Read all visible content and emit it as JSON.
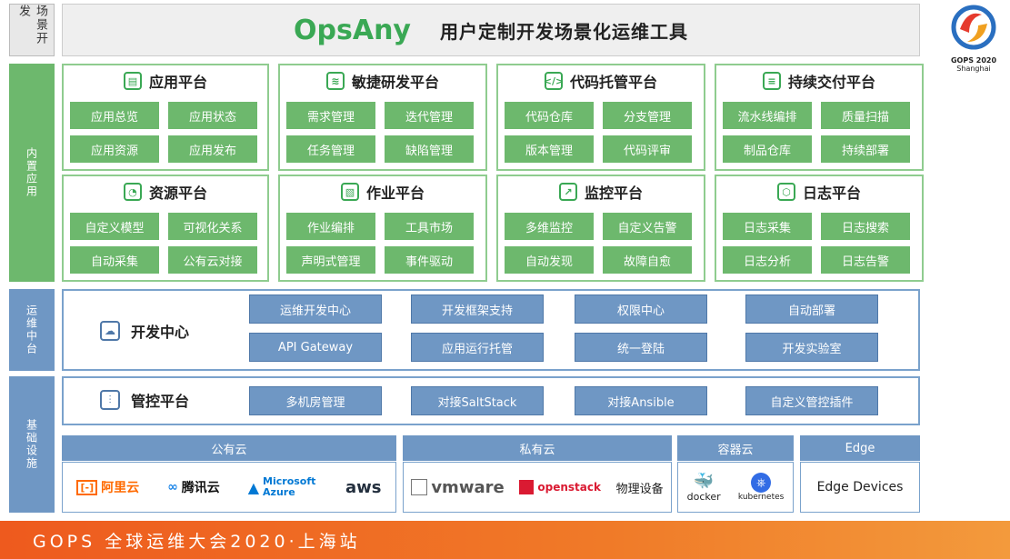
{
  "side_labels": {
    "scene_dev": "场景开发",
    "builtin_apps": "内置应用",
    "ops_middle": "运维中台",
    "infra": "基础设施"
  },
  "header": {
    "logo": "OpsAny",
    "title": "用户定制开发场景化运维工具"
  },
  "gops_logo": {
    "line1": "GOPS 2020",
    "line2": "Shanghai"
  },
  "panels": [
    {
      "title": "应用平台",
      "icon": "app-icon",
      "items": [
        "应用总览",
        "应用状态",
        "应用资源",
        "应用发布"
      ]
    },
    {
      "title": "敏捷研发平台",
      "icon": "layers-icon",
      "items": [
        "需求管理",
        "迭代管理",
        "任务管理",
        "缺陷管理"
      ]
    },
    {
      "title": "代码托管平台",
      "icon": "code-icon",
      "items": [
        "代码仓库",
        "分支管理",
        "版本管理",
        "代码评审"
      ]
    },
    {
      "title": "持续交付平台",
      "icon": "pipeline-icon",
      "items": [
        "流水线编排",
        "质量扫描",
        "制品仓库",
        "持续部署"
      ]
    },
    {
      "title": "资源平台",
      "icon": "resource-icon",
      "items": [
        "自定义模型",
        "可视化关系",
        "自动采集",
        "公有云对接"
      ]
    },
    {
      "title": "作业平台",
      "icon": "job-icon",
      "items": [
        "作业编排",
        "工具市场",
        "声明式管理",
        "事件驱动"
      ]
    },
    {
      "title": "监控平台",
      "icon": "monitor-icon",
      "items": [
        "多维监控",
        "自定义告警",
        "自动发现",
        "故障自愈"
      ]
    },
    {
      "title": "日志平台",
      "icon": "log-icon",
      "items": [
        "日志采集",
        "日志搜索",
        "日志分析",
        "日志告警"
      ]
    }
  ],
  "dev_center": {
    "title": "开发中心",
    "items": [
      "运维开发中心",
      "开发框架支持",
      "权限中心",
      "自动部署",
      "API Gateway",
      "应用运行托管",
      "统一登陆",
      "开发实验室"
    ]
  },
  "control": {
    "title": "管控平台",
    "items": [
      "多机房管理",
      "对接SaltStack",
      "对接Ansible",
      "自定义管控插件"
    ]
  },
  "clouds": {
    "public": {
      "title": "公有云",
      "vendors": [
        "阿里云",
        "腾讯云",
        "Microsoft Azure",
        "aws"
      ]
    },
    "private": {
      "title": "私有云",
      "vendors": [
        "vmware",
        "openstack",
        "物理设备"
      ]
    },
    "container": {
      "title": "容器云",
      "vendors": [
        "docker",
        "kubernetes"
      ]
    },
    "edge": {
      "title": "Edge",
      "body": "Edge Devices"
    }
  },
  "footer": "GOPS 全球运维大会2020·上海站",
  "colors": {
    "green": "#6db86d",
    "blue": "#6f97c4",
    "brand_green": "#3aa854",
    "footer_orange": "#ee5a1e"
  }
}
